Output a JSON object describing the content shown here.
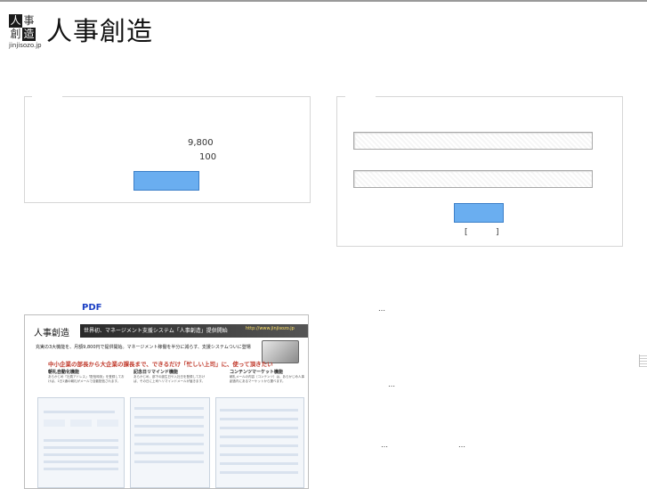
{
  "logo": {
    "mark_chars": [
      "人",
      "事",
      "創",
      "造"
    ],
    "domain": "jinjisozo.jp",
    "title": "人事創造"
  },
  "left_panel": {
    "price": "9,800",
    "quantity": "100"
  },
  "right_panel": {
    "field1_value": "",
    "field2_value": "",
    "bracket_text": "[           ]"
  },
  "pdf_link": "PDF",
  "ellipses": [
    "…",
    "…",
    "…",
    "…"
  ],
  "flyer": {
    "logo_text": "人事創造",
    "band_text": "世界初、マネージメント支援システム「人事創造」提供開始",
    "url": "http://www.jinjisozo.jp",
    "subtitle": "充実の3大機能を、月額9,800円で提供開始。マネージメント稼働を半分に減らす、支援システムついに登場",
    "headline": "中小企業の部長から大企業の課長まで、できるだけ「忙しい上司」に、使って頂きたい",
    "features": [
      {
        "title": "朝礼自動化機能",
        "body": "あらかじめ「社員アドレス」「配信時刻」を登録しておけば、1日1通の朝礼がメールで自動配信されます。"
      },
      {
        "title": "記念日リマインド機能",
        "body": "あらかじめ、部下の誕生日や入社日を登録しておけば、その日に上司へリマインドメールが届きます。"
      },
      {
        "title": "コンテンツマーケット機能",
        "body": "朝礼メールの内容（コンテンツ）は、あらかじめ人事創造内にあるマーケットから選べます。"
      }
    ]
  }
}
